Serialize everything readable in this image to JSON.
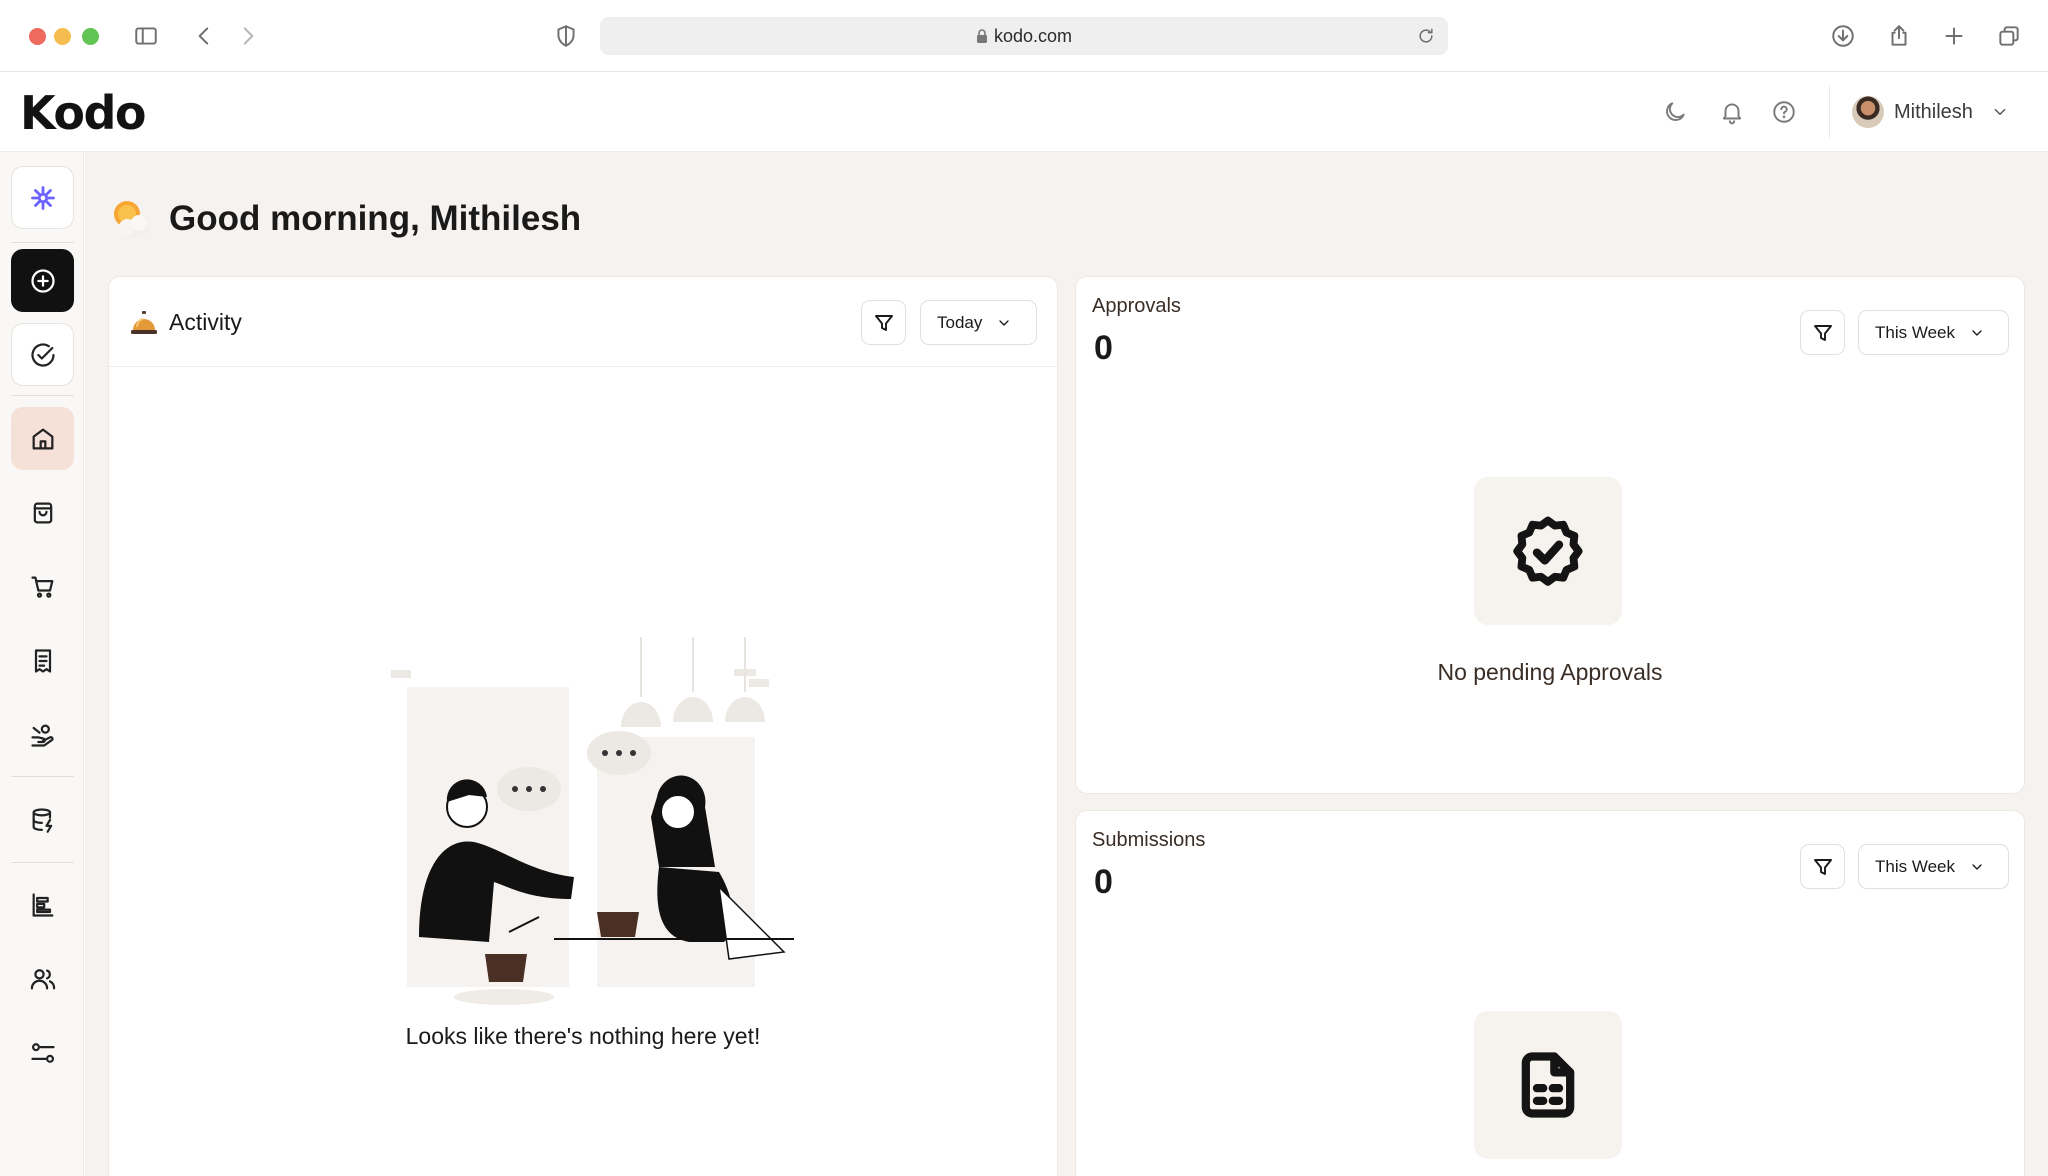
{
  "browser": {
    "url": "kodo.com"
  },
  "header": {
    "logo": "Kodo",
    "user_name": "Mithilesh"
  },
  "greeting": {
    "text": "Good morning, Mithilesh"
  },
  "activity": {
    "title": "Activity",
    "period": "Today",
    "empty_message": "Looks like there's nothing here yet!"
  },
  "approvals": {
    "title": "Approvals",
    "count": "0",
    "period": "This Week",
    "empty_message": "No pending Approvals"
  },
  "submissions": {
    "title": "Submissions",
    "count": "0",
    "period": "This Week"
  },
  "icons": {
    "sidebar": [
      "kodo-spark-icon",
      "add-circle-icon",
      "check-circle-icon",
      "home-icon",
      "shopping-bag-icon",
      "cart-icon",
      "receipt-icon",
      "hand-coins-icon",
      "database-icon",
      "reports-icon",
      "users-icon",
      "settings-sliders-icon"
    ],
    "header": [
      "moon-icon",
      "bell-icon",
      "help-icon"
    ]
  },
  "colors": {
    "accent": "#6c63ff",
    "active_nav_bg": "#f6e1d8",
    "main_bg": "#f5f2ef",
    "primary_dark": "#111111"
  }
}
